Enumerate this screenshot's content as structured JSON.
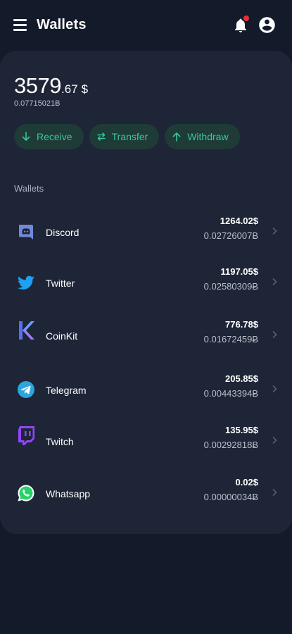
{
  "header": {
    "title": "Wallets",
    "menu_icon": "hamburger-menu-icon",
    "bell_icon": "bell-icon",
    "profile_icon": "account-circle-icon",
    "notification_color": "#e5313b"
  },
  "balance": {
    "integer": "3579",
    "decimal": ".67",
    "currency": "$",
    "btc": "0.07715021Ƀ"
  },
  "actions": [
    {
      "label": "Receive",
      "icon": "arrow-down-icon"
    },
    {
      "label": "Transfer",
      "icon": "swap-arrows-icon"
    },
    {
      "label": "Withdraw",
      "icon": "arrow-up-icon"
    }
  ],
  "accent_color": "#36c7a3",
  "section_label": "Wallets",
  "wallets": [
    {
      "name": "Discord",
      "usd": "1264.02$",
      "btc": "0.02726007Ƀ",
      "icon": "discord-icon"
    },
    {
      "name": "Twitter",
      "usd": "1197.05$",
      "btc": "0.02580309Ƀ",
      "icon": "twitter-icon"
    },
    {
      "name": "CoinKit",
      "usd": "776.78$",
      "btc": "0.01672459Ƀ",
      "icon": "coinkit-icon"
    },
    {
      "name": "Telegram",
      "usd": "205.85$",
      "btc": "0.00443394Ƀ",
      "icon": "telegram-icon"
    },
    {
      "name": "Twitch",
      "usd": "135.95$",
      "btc": "0.00292818Ƀ",
      "icon": "twitch-icon"
    },
    {
      "name": "Whatsapp",
      "usd": "0.02$",
      "btc": "0.00000034Ƀ",
      "icon": "whatsapp-icon"
    }
  ]
}
